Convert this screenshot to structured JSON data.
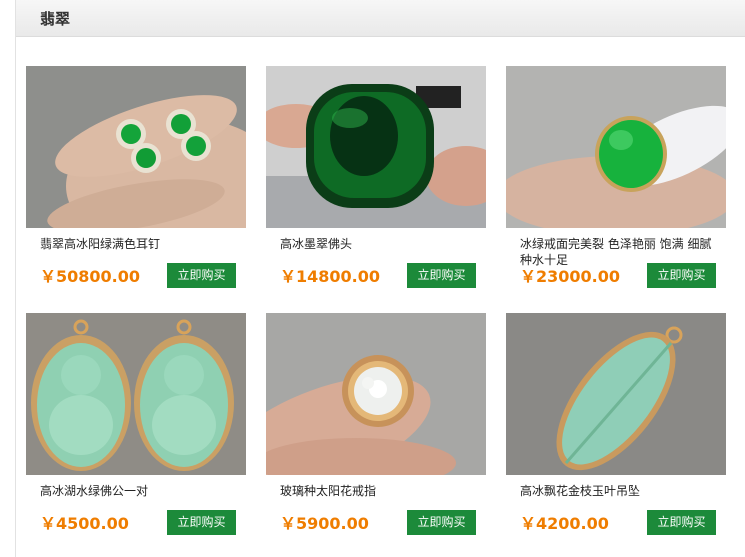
{
  "header": {
    "title": "翡翠"
  },
  "products": [
    {
      "name": "翡翠高冰阳绿满色耳钉",
      "price": "￥50800.00",
      "buy_label": "立即购买",
      "image_icon": "green-jade-earrings-icon"
    },
    {
      "name": "高冰墨翠佛头",
      "price": "￥14800.00",
      "buy_label": "立即购买",
      "image_icon": "dark-jade-buddha-icon"
    },
    {
      "name": "冰绿戒面完美裂 色泽艳丽 饱满 细腻种水十足",
      "price": "￥23000.00",
      "buy_label": "立即购买",
      "image_icon": "green-jade-ring-icon"
    },
    {
      "name": "高冰湖水绿佛公一对",
      "price": "￥4500.00",
      "buy_label": "立即购买",
      "image_icon": "jade-buddha-pendants-icon"
    },
    {
      "name": "玻璃种太阳花戒指",
      "price": "￥5900.00",
      "buy_label": "立即购买",
      "image_icon": "glass-jade-flower-ring-icon"
    },
    {
      "name": "高冰飘花金枝玉叶吊坠",
      "price": "￥4200.00",
      "buy_label": "立即购买",
      "image_icon": "jade-leaf-pendant-icon"
    }
  ]
}
